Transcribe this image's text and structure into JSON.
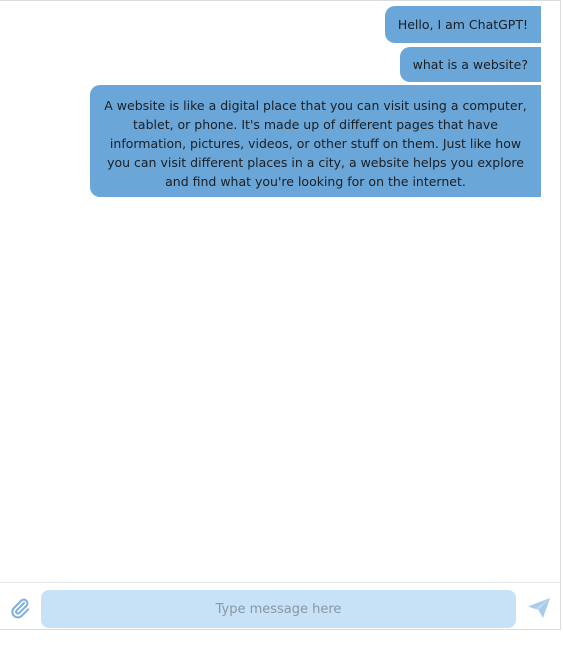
{
  "chat": {
    "messages": [
      {
        "sender": "user",
        "text": "Hello, I am ChatGPT!"
      },
      {
        "sender": "user",
        "text": "what is a website?"
      },
      {
        "sender": "assistant",
        "text": "A website is like a digital place that you can visit using a computer, tablet, or phone. It's made up of different pages that have information, pictures, videos, or other stuff on them. Just like how you can visit different places in a city, a website helps you explore and find what you're looking for on the internet."
      }
    ]
  },
  "composer": {
    "placeholder": "Type message here",
    "value": "",
    "attach_icon": "paperclip-icon",
    "send_icon": "paper-plane-icon"
  },
  "colors": {
    "bubble": "#6aa6d8",
    "input_background": "#c7e1f6",
    "icon": "#8fb8dc"
  }
}
